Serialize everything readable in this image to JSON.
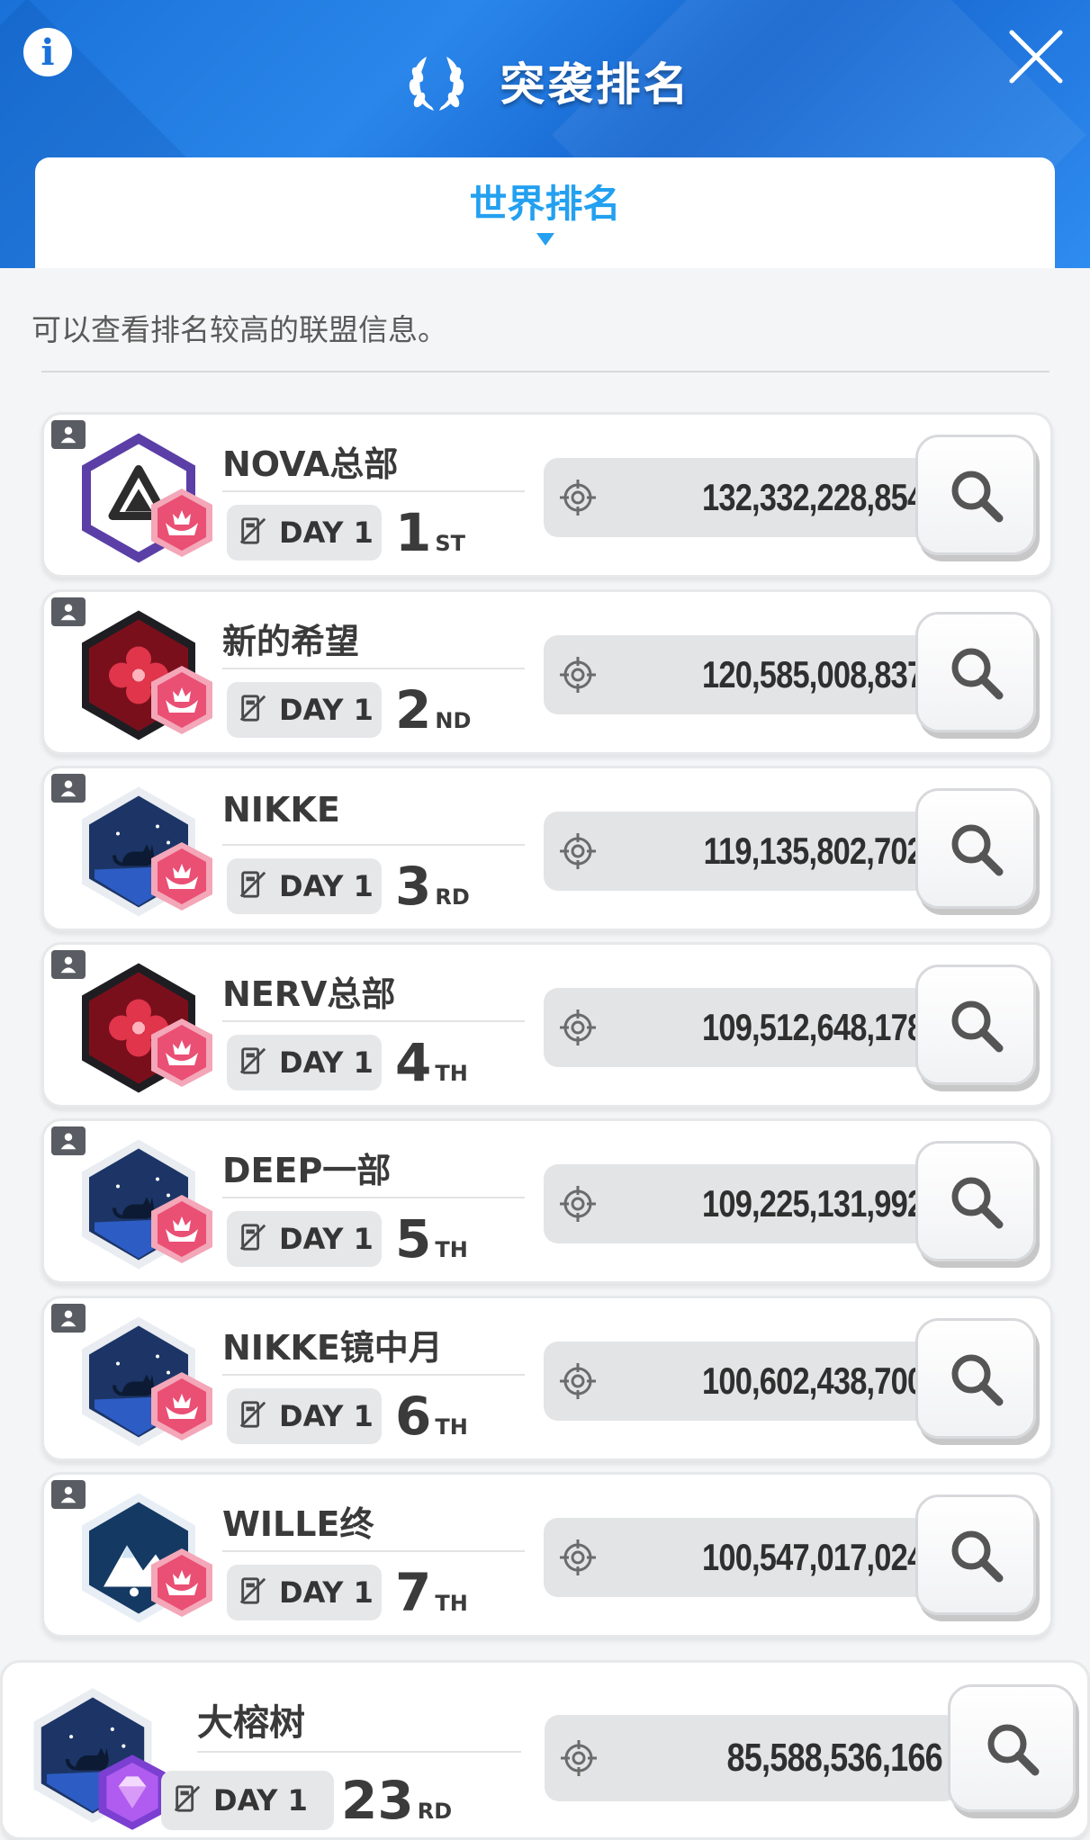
{
  "header": {
    "title": "突袭排名",
    "info_label": "i",
    "close_icon": "close-icon",
    "laurel_icon": "laurel-icon"
  },
  "tabs": {
    "active": "世界排名"
  },
  "description": "可以查看排名较高的联盟信息。",
  "colors": {
    "header_blue": "#1a72d8",
    "tab_active": "#23a0f0",
    "badge_red": "#a8192a",
    "badge_navy": "#1c3566",
    "medal_pink": "#ef5a7d",
    "medal_purple": "#a54ee6"
  },
  "rankings": [
    {
      "name": "NOVA总部",
      "day": "DAY 1",
      "rank": "1",
      "suffix": "ST",
      "score": "132,332,228,854",
      "emblem": "triangle-emblem"
    },
    {
      "name": "新的希望",
      "day": "DAY 1",
      "rank": "2",
      "suffix": "ND",
      "score": "120,585,008,837",
      "emblem": "red-flower-emblem"
    },
    {
      "name": "NIKKE",
      "day": "DAY 1",
      "rank": "3",
      "suffix": "RD",
      "score": "119,135,802,702",
      "emblem": "cat-emblem"
    },
    {
      "name": "NERV总部",
      "day": "DAY 1",
      "rank": "4",
      "suffix": "TH",
      "score": "109,512,648,178",
      "emblem": "red-flower-emblem"
    },
    {
      "name": "DEEP一部",
      "day": "DAY 1",
      "rank": "5",
      "suffix": "TH",
      "score": "109,225,131,992",
      "emblem": "cat-emblem"
    },
    {
      "name": "NIKKE镜中月",
      "day": "DAY 1",
      "rank": "6",
      "suffix": "TH",
      "score": "100,602,438,700",
      "emblem": "cat-emblem"
    },
    {
      "name": "WILLE终",
      "day": "DAY 1",
      "rank": "7",
      "suffix": "TH",
      "score": "100,547,017,024",
      "emblem": "mountain-emblem"
    }
  ],
  "my_union": {
    "name": "大榕树",
    "day": "DAY 1",
    "rank": "23",
    "suffix": "RD",
    "score": "85,588,536,166",
    "emblem": "cat-emblem"
  }
}
